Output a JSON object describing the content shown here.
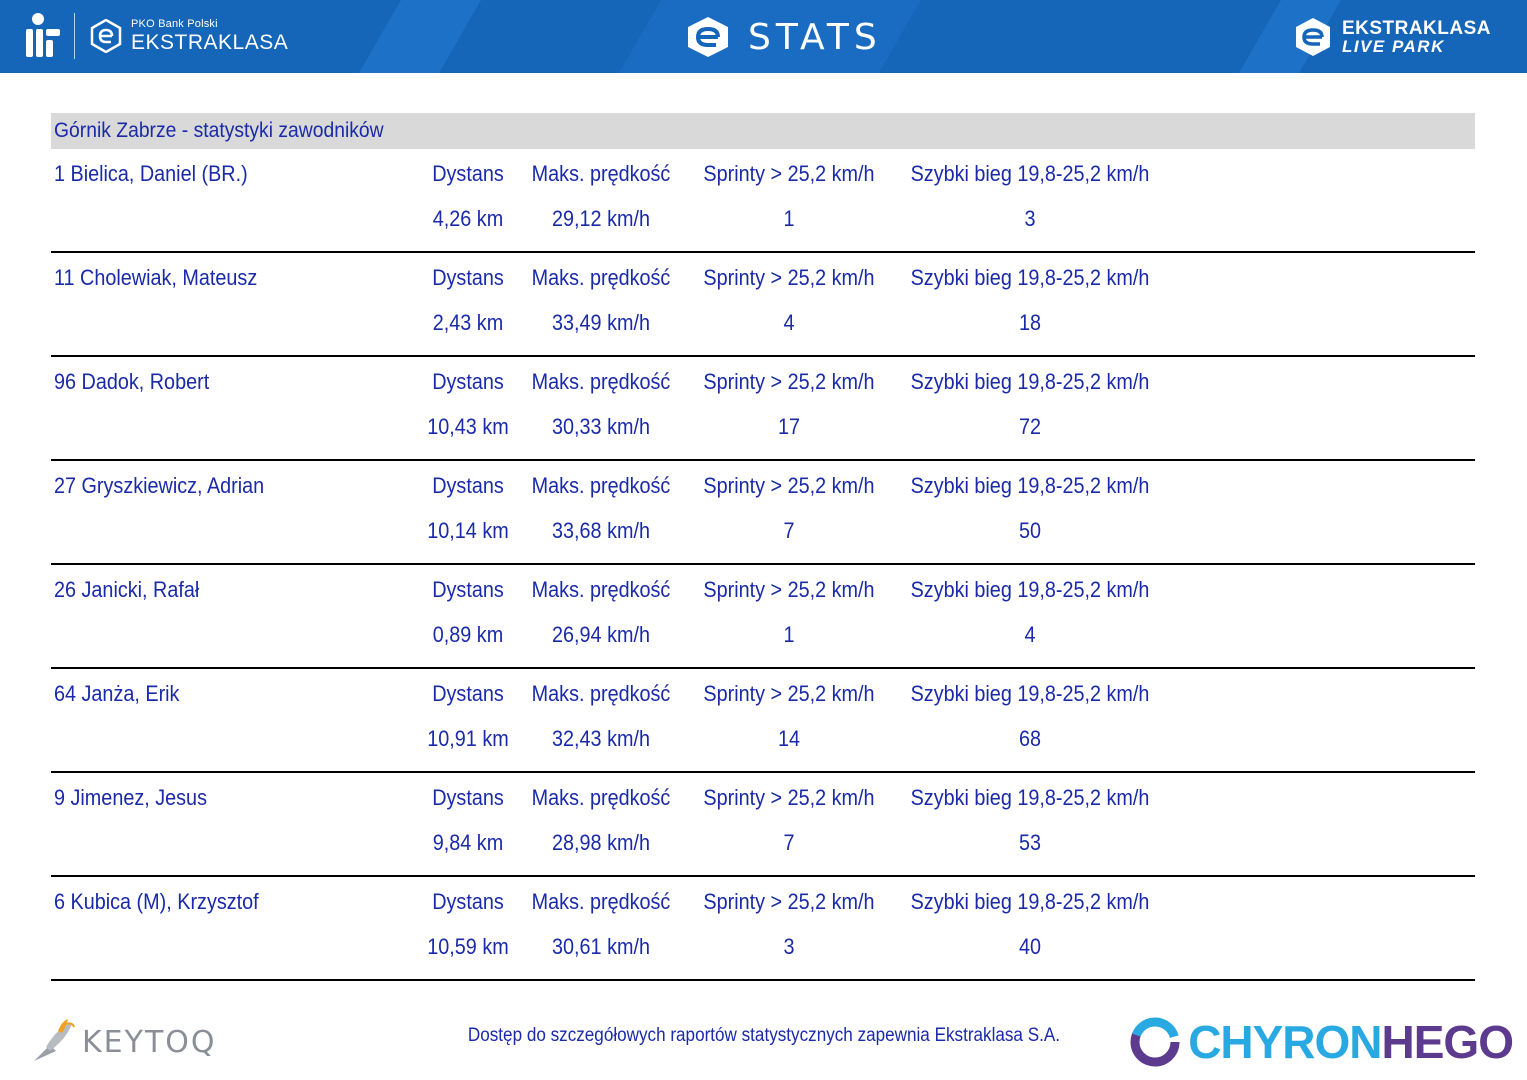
{
  "header": {
    "sponsor_small": "PKO Bank Polski",
    "sponsor_big": "EKSTRAKLASA",
    "title": "STATS",
    "right_logo_line1": "EKSTRAKLASA",
    "right_logo_line2": "LIVE PARK",
    "brand_color": "#1565b9"
  },
  "team": {
    "title": "Górnik Zabrze - statystyki zawodników"
  },
  "labels": {
    "distance": "Dystans",
    "max_speed": "Maks. prędkość",
    "sprints": "Sprinty > 25,2 km/h",
    "fast_run": "Szybki bieg 19,8-25,2 km/h"
  },
  "players": [
    {
      "name": "1  Bielica, Daniel (BR.)",
      "distance": "4,26 km",
      "max_speed": "29,12 km/h",
      "sprints": "1",
      "fast_run": "3"
    },
    {
      "name": "11  Cholewiak, Mateusz",
      "distance": "2,43 km",
      "max_speed": "33,49 km/h",
      "sprints": "4",
      "fast_run": "18"
    },
    {
      "name": "96  Dadok, Robert",
      "distance": "10,43 km",
      "max_speed": "30,33 km/h",
      "sprints": "17",
      "fast_run": "72"
    },
    {
      "name": "27  Gryszkiewicz, Adrian",
      "distance": "10,14 km",
      "max_speed": "33,68 km/h",
      "sprints": "7",
      "fast_run": "50"
    },
    {
      "name": "26  Janicki, Rafał",
      "distance": "0,89 km",
      "max_speed": "26,94 km/h",
      "sprints": "1",
      "fast_run": "4"
    },
    {
      "name": "64  Janża, Erik",
      "distance": "10,91 km",
      "max_speed": "32,43 km/h",
      "sprints": "14",
      "fast_run": "68"
    },
    {
      "name": "9  Jimenez, Jesus",
      "distance": "9,84 km",
      "max_speed": "28,98 km/h",
      "sprints": "7",
      "fast_run": "53"
    },
    {
      "name": "6  Kubica (M), Krzysztof",
      "distance": "10,59 km",
      "max_speed": "30,61 km/h",
      "sprints": "3",
      "fast_run": "40"
    }
  ],
  "footer": {
    "note": "Dostęp do szczegółowych raportów statystycznych zapewnia Ekstraklasa S.A.",
    "left_logo": "KEYTOQ",
    "right_logo_part1": "CHYRON",
    "right_logo_part2": "HEGO"
  }
}
